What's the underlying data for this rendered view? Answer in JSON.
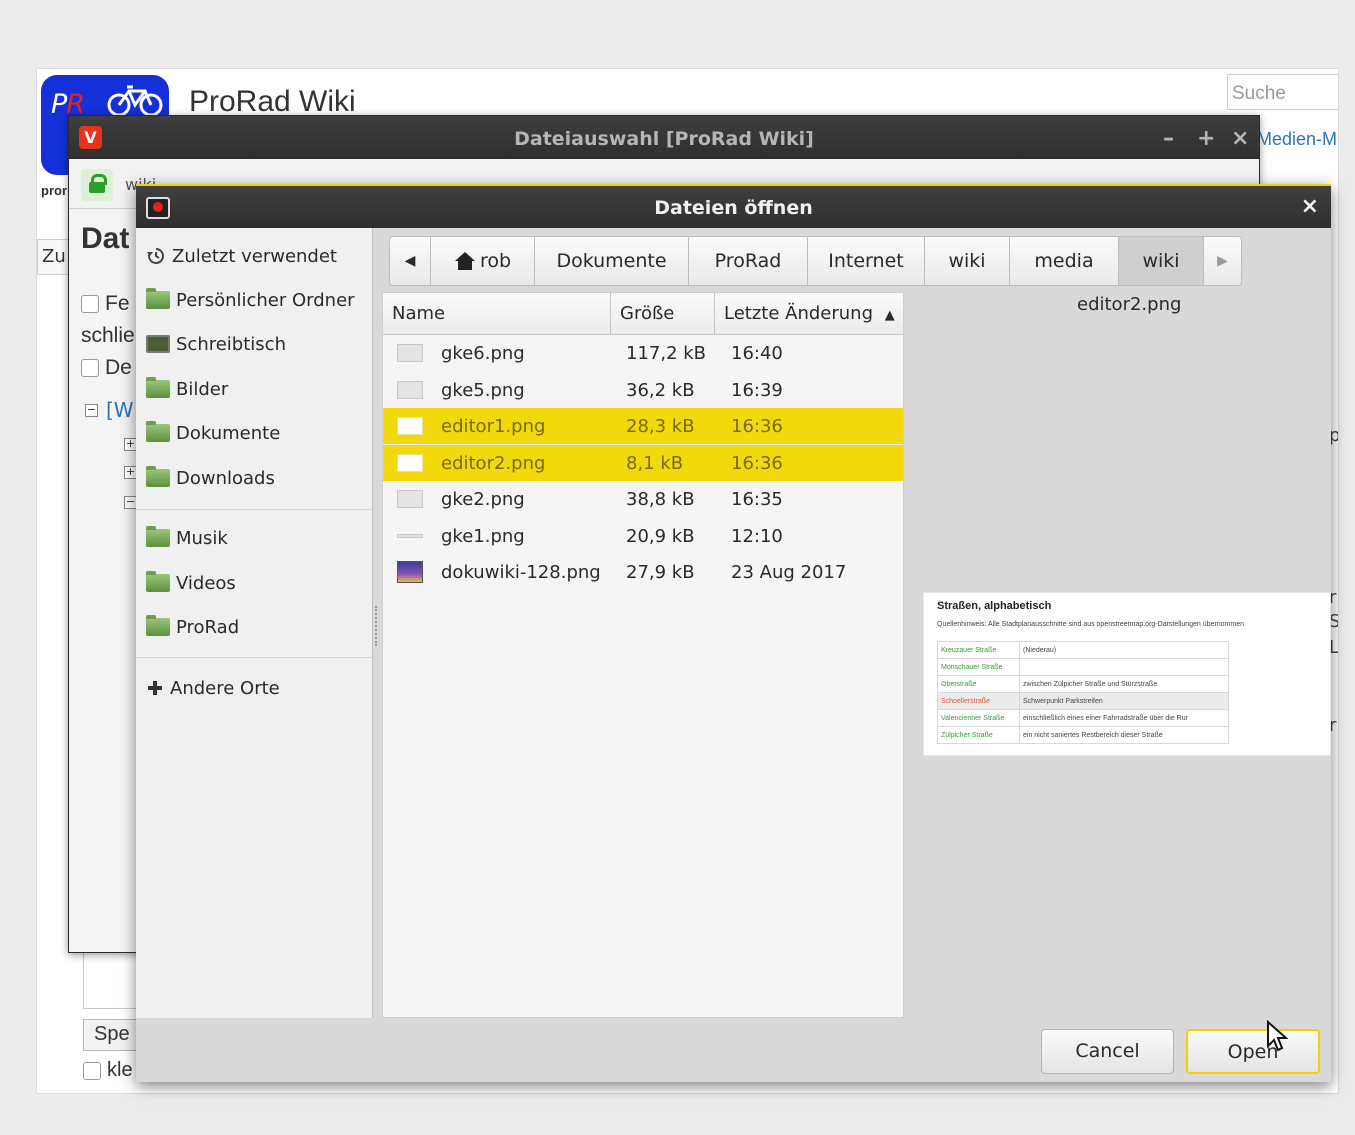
{
  "wiki": {
    "logo_text_pro": "P",
    "logo_text_r": "R",
    "title": "ProRad Wiki",
    "search_placeholder": "Suche",
    "media_link": "Medien-M",
    "tagline": "pror",
    "zu_label": "Zu",
    "save_label": "Spe",
    "klein_label": "kle",
    "right_fragments": [
      "p",
      "r",
      "S",
      "L",
      "r"
    ]
  },
  "popup": {
    "title": "Dateiauswahl [ProRad Wiki]",
    "url_fragment": "wiki",
    "heading": "Dat",
    "row1": "Fe",
    "row2": "schlie",
    "row3": "De",
    "wiki_link": "[W"
  },
  "dialog": {
    "title": "Dateien öffnen",
    "close": "×",
    "sidebar": [
      {
        "label": "Zuletzt verwendet",
        "icon": "recent-icon"
      },
      {
        "label": "Persönlicher Ordner",
        "icon": "home-folder-icon"
      },
      {
        "label": "Schreibtisch",
        "icon": "desktop-icon"
      },
      {
        "label": "Bilder",
        "icon": "pictures-folder-icon"
      },
      {
        "label": "Dokumente",
        "icon": "documents-folder-icon"
      },
      {
        "label": "Downloads",
        "icon": "downloads-folder-icon"
      },
      {
        "label": "Musik",
        "icon": "music-folder-icon"
      },
      {
        "label": "Videos",
        "icon": "videos-folder-icon"
      },
      {
        "label": "ProRad",
        "icon": "folder-icon"
      },
      {
        "label": "Andere Orte",
        "icon": "plus-icon"
      }
    ],
    "path": [
      "rob",
      "Dokumente",
      "ProRad",
      "Internet",
      "wiki",
      "media",
      "wiki"
    ],
    "active_path_index": 6,
    "columns": {
      "name": "Name",
      "size": "Größe",
      "modified": "Letzte Änderung"
    },
    "sort_column": "modified",
    "sort_direction": "ascending",
    "files": [
      {
        "name": "gke6.png",
        "size": "117,2 kB",
        "modified": "16:40",
        "selected": false
      },
      {
        "name": "gke5.png",
        "size": "36,2 kB",
        "modified": "16:39",
        "selected": false
      },
      {
        "name": "editor1.png",
        "size": "28,3 kB",
        "modified": "16:36",
        "selected": true
      },
      {
        "name": "editor2.png",
        "size": "8,1 kB",
        "modified": "16:36",
        "selected": true
      },
      {
        "name": "gke2.png",
        "size": "38,8 kB",
        "modified": "16:35",
        "selected": false
      },
      {
        "name": "gke1.png",
        "size": "20,9 kB",
        "modified": "12:10",
        "selected": false
      },
      {
        "name": "dokuwiki-128.png",
        "size": "27,9 kB",
        "modified": "23 Aug 2017",
        "selected": false
      }
    ],
    "preview": {
      "filename": "editor2.png",
      "heading": "Straßen, alphabetisch",
      "note": "Quellenhinweis: Alle Stadtplanausschnitte sind aus openstreetmap.org-Darstellungen übernommen",
      "rows": [
        {
          "street": "Kreuzauer Straße",
          "desc": "(Niederau)"
        },
        {
          "street": "Monschauer Straße",
          "desc": ""
        },
        {
          "street": "Oberstraße",
          "desc": "zwischen Zülpicher Straße und Stürzstraße"
        },
        {
          "street": "Schoellerstraße",
          "desc": "Schwerpunkt Parkstreifen"
        },
        {
          "street": "Valencienner Straße",
          "desc": "einschließlich eines einer Fahrradstraße über die Rur"
        },
        {
          "street": "Zülpicher Straße",
          "desc": "ein nicht saniertes Restbereich dieser Straße"
        }
      ]
    },
    "buttons": {
      "cancel": "Cancel",
      "open": "Open"
    }
  },
  "colors": {
    "selection": "#f3d90b",
    "focus": "#f2d100",
    "logo_blue": "#1530d8",
    "vivaldi_red": "#e8321d"
  }
}
